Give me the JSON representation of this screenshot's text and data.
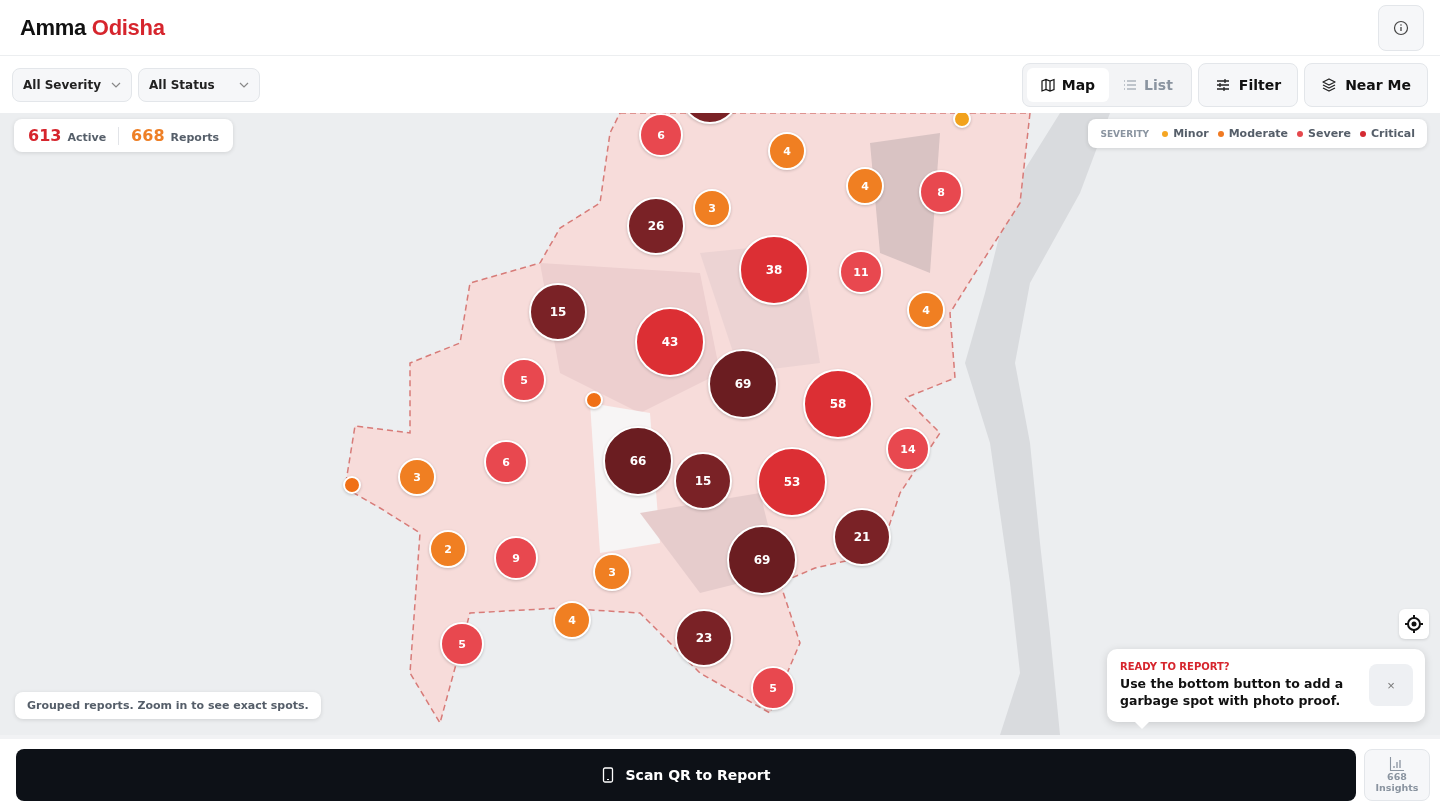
{
  "app": {
    "title_part1": "Amma",
    "title_part2": "Odisha"
  },
  "filters": [
    {
      "label": "All Severity"
    },
    {
      "label": "All Status"
    }
  ],
  "view_toggle": [
    {
      "label": "Map",
      "selected": true
    },
    {
      "label": "List",
      "selected": false
    }
  ],
  "actions": [
    {
      "label": "Filter",
      "kind": "filter"
    },
    {
      "label": "Near Me",
      "kind": "layers"
    }
  ],
  "stats": {
    "active_count": "613",
    "active_label": "Active",
    "reports_count": "668",
    "reports_label": "Reports"
  },
  "legend": {
    "title": "SEVERITY",
    "items": [
      {
        "label": "Minor",
        "color": "#f5a623"
      },
      {
        "label": "Moderate",
        "color": "#f07a22"
      },
      {
        "label": "Severe",
        "color": "#e5484d"
      },
      {
        "label": "Critical",
        "color": "#d42a32"
      }
    ]
  },
  "markers": [
    {
      "kind": "cluster",
      "color": "#7a2226"
    },
    {
      "count": "6",
      "color": "#e8484f"
    },
    {
      "count": "4",
      "color": "#f07f22"
    },
    {
      "kind": "dot",
      "color": "#f2a21c"
    },
    {
      "count": "4",
      "color": "#f07f22"
    },
    {
      "count": "8",
      "color": "#e8484f"
    },
    {
      "count": "3",
      "color": "#f07f22"
    },
    {
      "count": "26",
      "color": "#7a2226"
    },
    {
      "count": "38",
      "color": "#dc2f34"
    },
    {
      "count": "11",
      "color": "#e8484f"
    },
    {
      "count": "4",
      "color": "#f07f22"
    },
    {
      "count": "15",
      "color": "#7a2226"
    },
    {
      "count": "43",
      "color": "#dc2f34"
    },
    {
      "count": "5",
      "color": "#e8484f"
    },
    {
      "kind": "dot",
      "color": "#f07016"
    },
    {
      "count": "69",
      "color": "#6b1d21"
    },
    {
      "count": "58",
      "color": "#dc2f34"
    },
    {
      "count": "14",
      "color": "#e8484f"
    },
    {
      "count": "66",
      "color": "#6b1d21"
    },
    {
      "count": "15",
      "color": "#7a2226"
    },
    {
      "count": "53",
      "color": "#dc2f34"
    },
    {
      "count": "6",
      "color": "#e8484f"
    },
    {
      "count": "3",
      "color": "#f07f22"
    },
    {
      "kind": "dot",
      "color": "#f07016"
    },
    {
      "count": "21",
      "color": "#7a2226"
    },
    {
      "count": "2",
      "color": "#f07f22"
    },
    {
      "count": "9",
      "color": "#e8484f"
    },
    {
      "count": "69",
      "color": "#6b1d21"
    },
    {
      "count": "3",
      "color": "#f07f22"
    },
    {
      "count": "4",
      "color": "#f07f22"
    },
    {
      "count": "23",
      "color": "#7a2226"
    },
    {
      "count": "5",
      "color": "#e8484f"
    },
    {
      "count": "5",
      "color": "#e8484f"
    }
  ],
  "hint": "Grouped reports. Zoom in to see exact spots.",
  "tooltip": {
    "title": "READY TO REPORT?",
    "message": "Use the bottom button to add a garbage spot with photo proof.",
    "close": "×"
  },
  "bottom_bar": {
    "primary": "Scan QR to Report",
    "insights_count": "668",
    "insights_label": "Insights"
  }
}
